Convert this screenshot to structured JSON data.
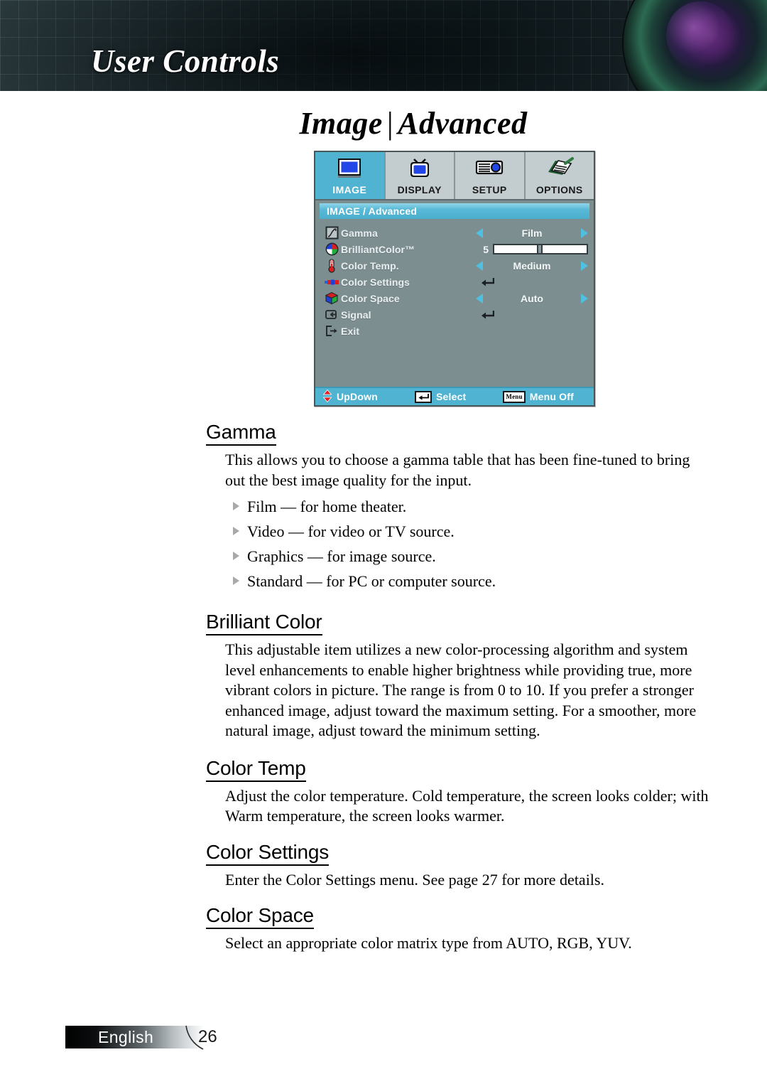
{
  "banner": {
    "title": "User Controls",
    "lens_icon": "projector-lens-photo"
  },
  "page_title": {
    "primary": "Image",
    "separator": "|",
    "secondary": "Advanced"
  },
  "osd": {
    "tabs": [
      {
        "label": "IMAGE",
        "icon": "image-screen-icon",
        "active": true
      },
      {
        "label": "DISPLAY",
        "icon": "display-tv-icon",
        "active": false
      },
      {
        "label": "SETUP",
        "icon": "setup-projector-icon",
        "active": false
      },
      {
        "label": "OPTIONS",
        "icon": "options-notepad-icon",
        "active": false
      }
    ],
    "breadcrumb": "IMAGE / Advanced",
    "rows": [
      {
        "label": "Gamma",
        "icon": "gamma-curve-icon",
        "control": "stepper",
        "value": "Film"
      },
      {
        "label": "BrilliantColor™",
        "icon": "color-wheel-icon",
        "control": "slider",
        "value": "5",
        "slider_percent": 46
      },
      {
        "label": "Color Temp.",
        "icon": "thermometer-icon",
        "control": "stepper",
        "value": "Medium"
      },
      {
        "label": "Color Settings",
        "icon": "color-bars-icon",
        "control": "enter",
        "value": ""
      },
      {
        "label": "Color Space",
        "icon": "rgb-cube-icon",
        "control": "stepper",
        "value": "Auto"
      },
      {
        "label": "Signal",
        "icon": "signal-input-icon",
        "control": "enter",
        "value": ""
      },
      {
        "label": "Exit",
        "icon": "exit-door-icon",
        "control": "none",
        "value": ""
      }
    ],
    "hints": [
      {
        "key_icon": "updown-arrows-icon",
        "key_label": "",
        "label": "UpDown"
      },
      {
        "key_icon": "enter-key-icon",
        "key_label": "↵",
        "label": "Select"
      },
      {
        "key_icon": "menu-key-icon",
        "key_label": "Menu",
        "label": "Menu Off"
      }
    ],
    "colors": {
      "accent": "#4fb3d1",
      "body": "#7d8e91",
      "tab_inactive": "#c3ccce"
    }
  },
  "sections": [
    {
      "heading": "Gamma",
      "paragraphs": [
        "This allows you to choose a gamma table that has been fine-tuned to bring out the best image quality for the input."
      ],
      "bullets": [
        "Film — for home theater.",
        "Video — for video or TV source.",
        "Graphics — for image source.",
        "Standard — for PC or computer source."
      ]
    },
    {
      "heading": "Brilliant Color",
      "paragraphs": [
        "This adjustable item utilizes a new color-processing algorithm and system level enhancements to enable higher brightness while providing true, more vibrant colors in picture. The range is from 0 to 10. If you prefer a stronger enhanced image, adjust toward the maximum setting. For a smoother, more natural image, adjust toward the minimum setting."
      ],
      "bullets": []
    },
    {
      "heading": "Color Temp",
      "paragraphs": [
        "Adjust the color temperature. Cold temperature, the screen looks colder; with Warm temperature, the screen looks warmer."
      ],
      "bullets": []
    },
    {
      "heading": "Color Settings",
      "paragraphs": [
        "Enter the Color Settings menu. See page 27 for more details."
      ],
      "bullets": []
    },
    {
      "heading": "Color Space",
      "paragraphs": [
        "Select an appropriate color matrix type from AUTO, RGB, YUV."
      ],
      "bullets": []
    }
  ],
  "footer": {
    "language": "English",
    "page_number": "26"
  }
}
